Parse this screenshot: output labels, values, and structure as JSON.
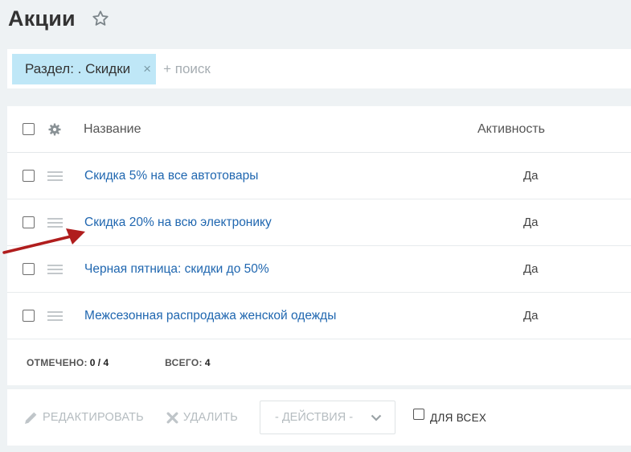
{
  "page": {
    "title": "Акции"
  },
  "filter": {
    "chip_label": "Раздел: . Скидки",
    "chip_close": "×",
    "search_placeholder": "+ поиск"
  },
  "grid": {
    "columns": {
      "name": "Название",
      "activity": "Активность"
    },
    "rows": [
      {
        "name": "Скидка 5% на все автотовары",
        "activity": "Да"
      },
      {
        "name": "Скидка 20% на всю электронику",
        "activity": "Да"
      },
      {
        "name": "Черная пятница: скидки до 50%",
        "activity": "Да"
      },
      {
        "name": "Межсезонная распродажа женской одежды",
        "activity": "Да"
      }
    ],
    "footer": {
      "selected_label": "ОТМЕЧЕНО:",
      "selected_value": "0 / 4",
      "total_label": "ВСЕГО:",
      "total_value": "4"
    }
  },
  "actions": {
    "edit_label": "РЕДАКТИРОВАТЬ",
    "delete_label": "УДАЛИТЬ",
    "select_label": "- ДЕЙСТВИЯ -",
    "for_all_label": "ДЛЯ ВСЕХ"
  },
  "colors": {
    "link": "#2067b0",
    "chip_bg": "#bfe7f7",
    "arrow": "#b01d1d",
    "page_bg": "#eef2f4"
  }
}
